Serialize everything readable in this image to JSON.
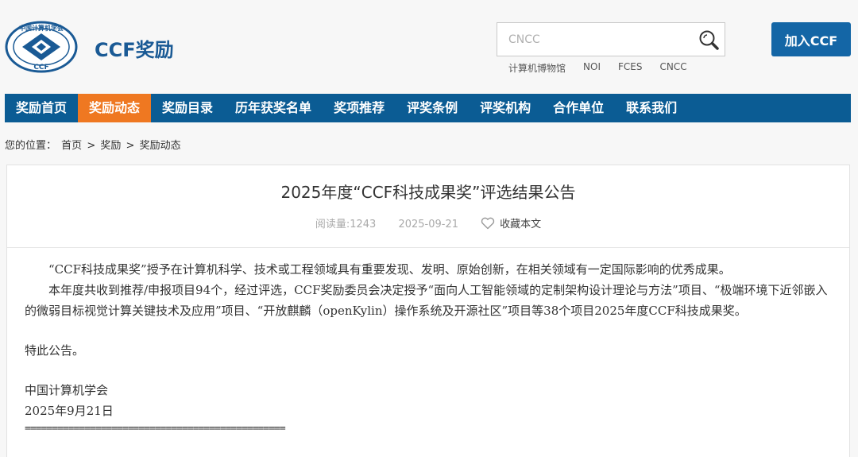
{
  "header": {
    "logo_text_top": "中国计算机学会",
    "logo_text_bottom": "CCF",
    "site_name": "CCF奖励",
    "search_placeholder": "CNCC",
    "quick_links": [
      "计算机博物馆",
      "NOI",
      "FCES",
      "CNCC"
    ],
    "join_label": "加入CCF"
  },
  "nav": {
    "items": [
      "奖励首页",
      "奖励动态",
      "奖励目录",
      "历年获奖名单",
      "奖项推荐",
      "评奖条例",
      "评奖机构",
      "合作单位",
      "联系我们"
    ],
    "active_index": 1
  },
  "breadcrumb": {
    "prefix": "您的位置：",
    "items": [
      "首页",
      "奖励",
      "奖励动态"
    ],
    "separator": ">"
  },
  "article": {
    "title": "2025年度“CCF科技成果奖”评选结果公告",
    "views": "阅读量:1243",
    "date": "2025-09-21",
    "favorite_label": "收藏本文",
    "para1": "“CCF科技成果奖”授予在计算机科学、技术或工程领域具有重要发现、发明、原始创新，在相关领域有一定国际影响的优秀成果。",
    "para2": "本年度共收到推荐/申报项目94个，经过评选，CCF奖励委员会决定授予“面向人工智能领域的定制架构设计理论与方法”项目、“极端环境下近邻嵌入的微弱目标视觉计算关键技术及应用”项目、“开放麒麟（openKylin）操作系统及开源社区”项目等38个项目2025年度CCF科技成果奖。",
    "notice": "特此公告。",
    "org": "中国计算机学会",
    "sign_date": "2025年9月21日",
    "divider": "================================================"
  },
  "colors": {
    "brand_blue": "#1466a6",
    "nav_blue": "#0b5c94",
    "active_orange": "#ef7821"
  }
}
